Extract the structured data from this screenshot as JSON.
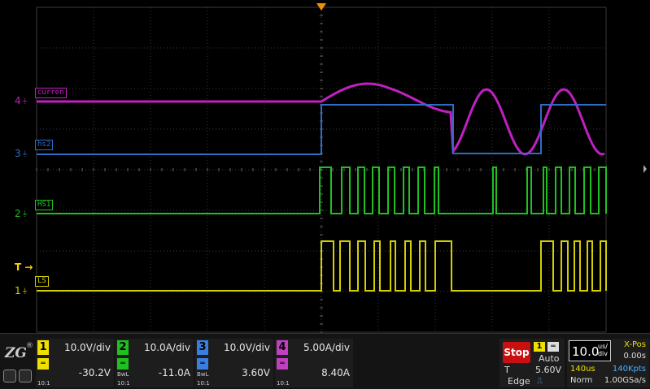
{
  "colors": {
    "ch1": "#d4cf00",
    "ch2": "#20c020",
    "ch3": "#2a6ec8",
    "ch4": "#c020c0",
    "grid": "#3a3a3a",
    "trigger_marker": "#f09000",
    "stop": "#c81010"
  },
  "screen": {
    "trigger_label": "T",
    "traces": [
      {
        "num": "4",
        "label": "curren",
        "color": "#c020c0"
      },
      {
        "num": "3",
        "label": "hs2",
        "color": "#2a6ec8"
      },
      {
        "num": "2",
        "label": "HS1",
        "color": "#20c020"
      },
      {
        "num": "1",
        "label": "LS",
        "color": "#d4cf00"
      }
    ],
    "ground_glyph": "⏚"
  },
  "channels": [
    {
      "num": "1",
      "scale": "10.0V/div",
      "offset": "-30.2V",
      "bw": "",
      "probe": "10:1",
      "color": "#f0e000"
    },
    {
      "num": "2",
      "scale": "10.0A/div",
      "offset": "-11.0A",
      "bw": "BwL",
      "probe": "10:1",
      "color": "#20c020"
    },
    {
      "num": "3",
      "scale": "10.0V/div",
      "offset": "3.60V",
      "bw": "BwL",
      "probe": "10:1",
      "color": "#3a7ee0"
    },
    {
      "num": "4",
      "scale": "5.00A/div",
      "offset": "8.40A",
      "bw": "",
      "probe": "10:1",
      "color": "#c040c0"
    }
  ],
  "trigger": {
    "status": "Stop",
    "source": "1",
    "mode": "Auto",
    "label": "T",
    "level": "5.60V",
    "type": "Edge"
  },
  "horizontal": {
    "time_div": "10.0",
    "time_unit_top": "us/",
    "time_unit_bottom": "div",
    "xpos_label": "X-Pos",
    "xpos_value": "0.00s",
    "record_length": "140us",
    "points": "140Kpts",
    "mode": "Norm",
    "sample_rate": "1.00GSa/s"
  }
}
